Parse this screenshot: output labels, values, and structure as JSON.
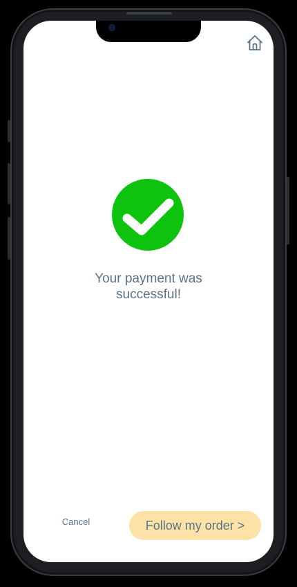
{
  "header": {
    "home_icon": "home-icon"
  },
  "status": {
    "icon": "checkmark-icon",
    "accent_color": "#0dc30d",
    "message": "Your payment was successful!"
  },
  "actions": {
    "cancel_label": "Cancel",
    "follow_label": "Follow my order >",
    "follow_bg_color": "#fde2a7",
    "text_color": "#5a7288"
  }
}
